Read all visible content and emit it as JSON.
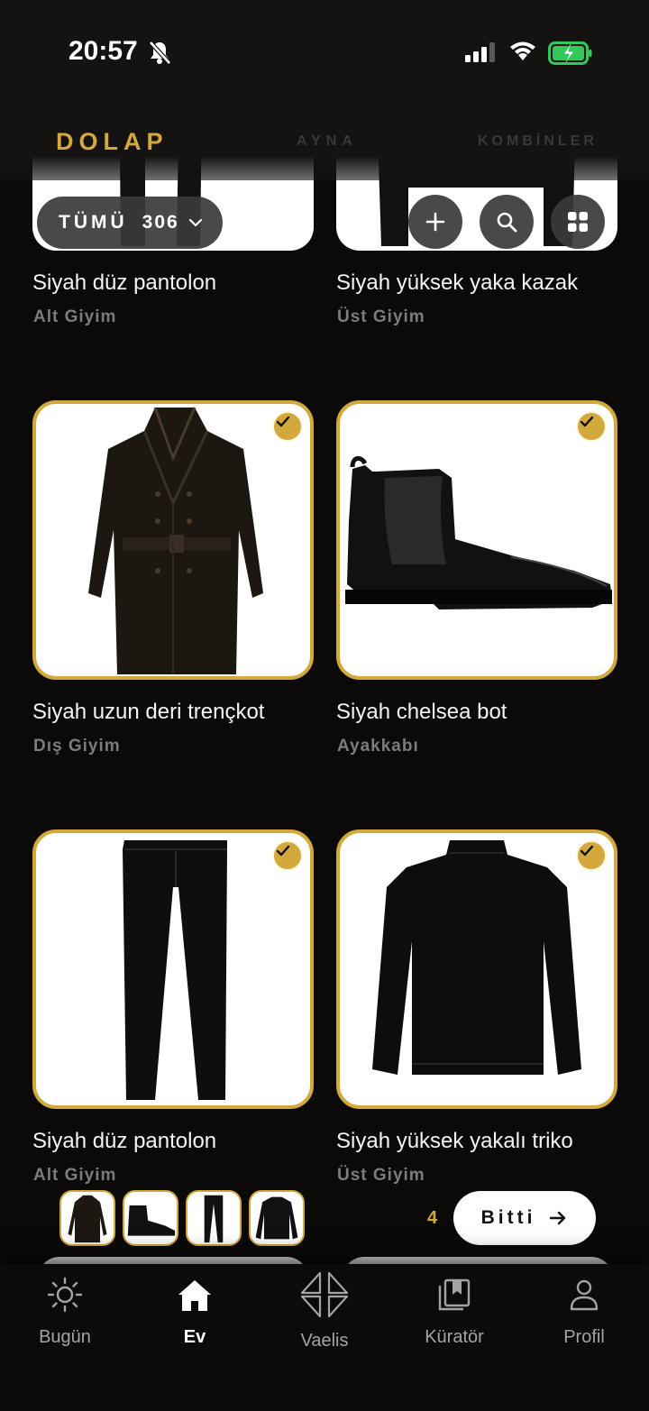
{
  "status_bar": {
    "time": "20:57"
  },
  "top_tabs": [
    {
      "label": "DOLAP",
      "active": true
    },
    {
      "label": "AYNA",
      "active": false
    },
    {
      "label": "KOMBİNLER",
      "active": false
    }
  ],
  "filter": {
    "label": "TÜMÜ",
    "count": "306"
  },
  "items": [
    {
      "title": "Siyah düz pantolon",
      "category": "Alt Giyim",
      "selected": false,
      "icon": "trousers"
    },
    {
      "title": "Siyah yüksek yaka kazak",
      "category": "Üst Giyim",
      "selected": false,
      "icon": "sweater"
    },
    {
      "title": "Siyah uzun deri trençkot",
      "category": "Dış Giyim",
      "selected": true,
      "icon": "trench-coat"
    },
    {
      "title": "Siyah chelsea bot",
      "category": "Ayakkabı",
      "selected": true,
      "icon": "chelsea-boot"
    },
    {
      "title": "Siyah düz pantolon",
      "category": "Alt Giyim",
      "selected": true,
      "icon": "trousers"
    },
    {
      "title": "Siyah yüksek yakalı triko",
      "category": "Üst Giyim",
      "selected": true,
      "icon": "sweater"
    }
  ],
  "selection_tray": {
    "count": "4",
    "done_label": "Bitti"
  },
  "bottom_nav": [
    {
      "label": "Bugün",
      "icon": "sun-icon",
      "active": false
    },
    {
      "label": "Ev",
      "icon": "home-icon",
      "active": true
    },
    {
      "label": "Vaelis",
      "icon": "vaelis-logo-icon",
      "active": false
    },
    {
      "label": "Küratör",
      "icon": "bookmarks-icon",
      "active": false
    },
    {
      "label": "Profil",
      "icon": "person-icon",
      "active": false
    }
  ],
  "colors": {
    "accent": "#d2a93a",
    "background": "#0b0a09",
    "muted": "#7e7c79"
  }
}
